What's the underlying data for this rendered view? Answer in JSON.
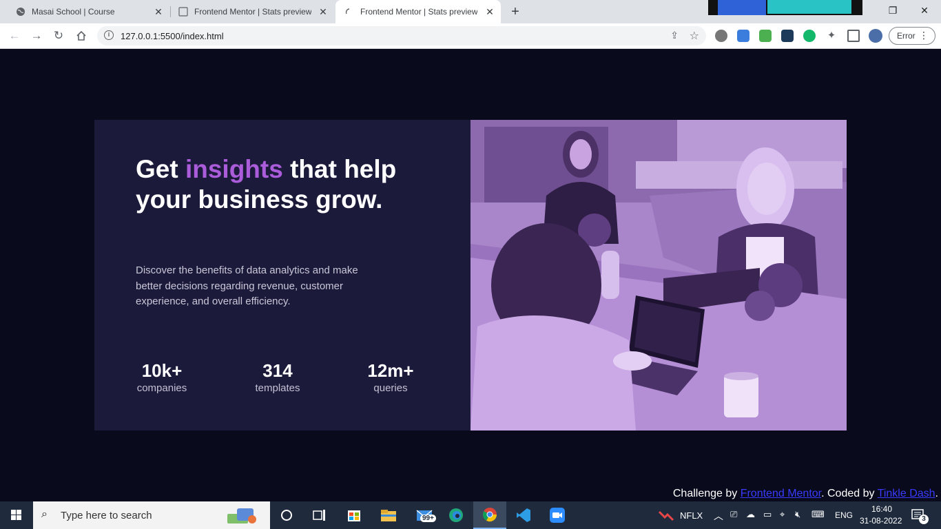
{
  "browser": {
    "tabs": [
      {
        "title": "Masai School | Course"
      },
      {
        "title": "Frontend Mentor | Stats preview"
      },
      {
        "title": "Frontend Mentor | Stats preview"
      }
    ],
    "new_tab_label": "+",
    "url": "127.0.0.1:5500/index.html",
    "error_label": "Error"
  },
  "hero": {
    "headline_pre": "Get ",
    "headline_accent": "insights",
    "headline_post": " that help your business grow.",
    "description": "Discover the benefits of data analytics and make better decisions regarding revenue, customer experience, and overall efficiency.",
    "stats": [
      {
        "value": "10k+",
        "label": "companies"
      },
      {
        "value": "314",
        "label": "templates"
      },
      {
        "value": "12m+",
        "label": "queries"
      }
    ]
  },
  "attribution": {
    "prefix": "Challenge by ",
    "link1": "Frontend Mentor",
    "middle": ". Coded by ",
    "link2": "Tinkle Dash",
    "suffix": "."
  },
  "taskbar": {
    "search_placeholder": "Type here to search",
    "mail_badge": "99+",
    "stock_ticker": "NFLX",
    "language": "ENG",
    "time": "16:40",
    "date": "31-08-2022",
    "notification_count": "3"
  },
  "colors": {
    "page_bg": "#090b1c",
    "card_bg": "#1c1a3a",
    "accent": "#aa5cdb",
    "image_tint": "#a985c9"
  }
}
